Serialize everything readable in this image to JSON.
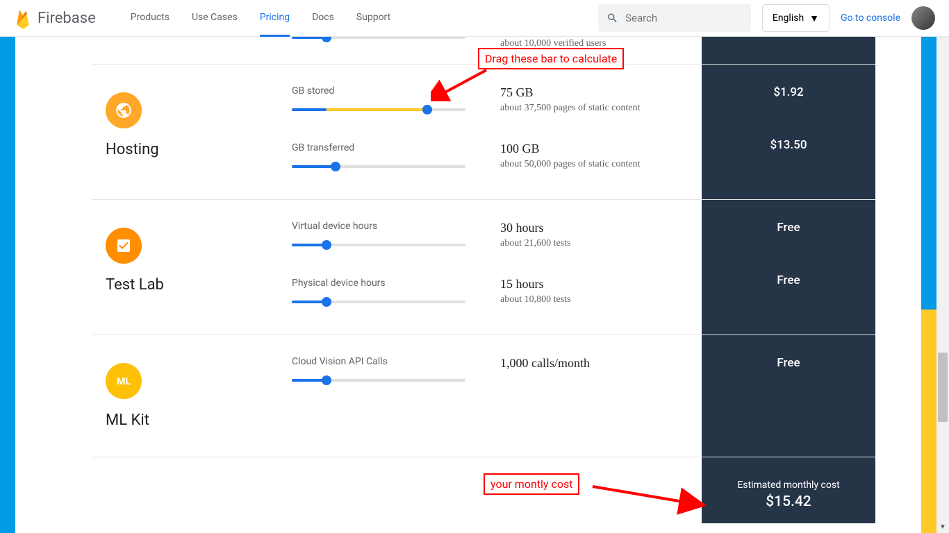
{
  "header": {
    "brand": "Firebase",
    "nav": [
      "Products",
      "Use Cases",
      "Pricing",
      "Docs",
      "Support"
    ],
    "active_nav": "Pricing",
    "search_placeholder": "Search",
    "language": "English",
    "console_link": "Go to console"
  },
  "partial_row": {
    "value_sub": "about 10,000 verified users"
  },
  "annotations": {
    "drag_text": "Drag these bar to calculate",
    "monthly_text": "your montly cost"
  },
  "sections": [
    {
      "name": "Hosting",
      "icon": "globe",
      "rows": [
        {
          "label": "GB stored",
          "value_main": "75 GB",
          "value_sub": "about 37,500 pages of static content",
          "price": "$1.92",
          "fill_blue_pct": 20,
          "fill_yellow_pct": 58,
          "thumb_pct": 78
        },
        {
          "label": "GB transferred",
          "value_main": "100 GB",
          "value_sub": "about 50,000 pages of static content",
          "price": "$13.50",
          "fill_blue_pct": 25,
          "fill_yellow_pct": 0,
          "thumb_pct": 25
        }
      ]
    },
    {
      "name": "Test Lab",
      "icon": "checklist",
      "rows": [
        {
          "label": "Virtual device hours",
          "value_main": "30 hours",
          "value_sub": "about 21,600 tests",
          "price": "Free",
          "fill_blue_pct": 20,
          "fill_yellow_pct": 0,
          "thumb_pct": 20
        },
        {
          "label": "Physical device hours",
          "value_main": "15 hours",
          "value_sub": "about 10,800 tests",
          "price": "Free",
          "fill_blue_pct": 20,
          "fill_yellow_pct": 0,
          "thumb_pct": 20
        }
      ]
    },
    {
      "name": "ML Kit",
      "icon": "ml",
      "rows": [
        {
          "label": "Cloud Vision API Calls",
          "value_main": "1,000 calls/month",
          "value_sub": "",
          "price": "Free",
          "fill_blue_pct": 20,
          "fill_yellow_pct": 0,
          "thumb_pct": 20
        }
      ]
    }
  ],
  "footer": {
    "label": "Estimated monthly cost",
    "value": "$15.42"
  }
}
